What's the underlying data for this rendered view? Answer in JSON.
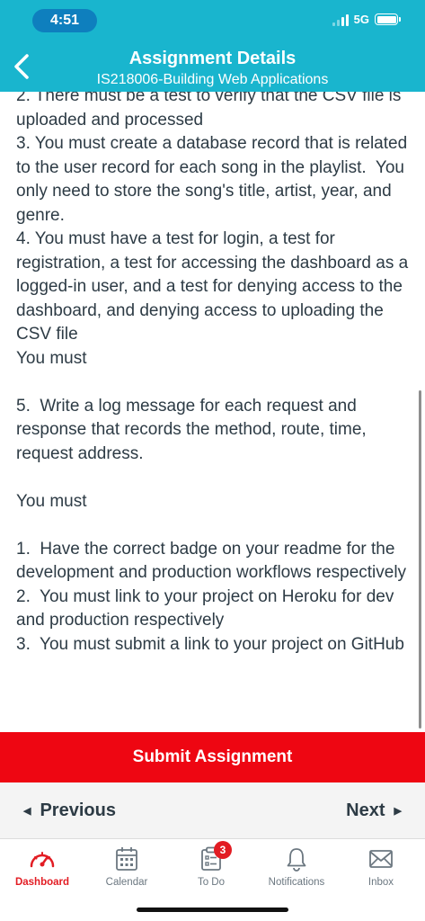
{
  "status_bar": {
    "time": "4:51",
    "network": "5G"
  },
  "header": {
    "title": "Assignment Details",
    "subtitle": "IS218006-Building Web Applications"
  },
  "content": {
    "lines": [
      "2. There must be a test to verify that the CSV file is uploaded and processed",
      "3. You must create a database record that is related to the user record for each song in the playlist.  You only need to store the song's title, artist, year, and genre.",
      "4. You must have a test for login, a test for registration, a test for accessing the dashboard as a logged-in user, and a test for denying access to the dashboard, and denying access to uploading the CSV file",
      "You must",
      "",
      "5.  Write a log message for each request and response that records the method, route, time, request address.",
      "",
      "You must",
      "",
      "1.  Have the correct badge on your readme for the development and production workflows respectively",
      "2.  You must link to your project on Heroku for dev and production respectively",
      "3.  You must submit a link to your project on GitHub"
    ]
  },
  "submit_button": {
    "label": "Submit Assignment"
  },
  "pager": {
    "previous_label": "Previous",
    "next_label": "Next"
  },
  "tabbar": {
    "tabs": [
      {
        "label": "Dashboard",
        "icon": "speedometer-icon",
        "active": true
      },
      {
        "label": "Calendar",
        "icon": "calendar-icon"
      },
      {
        "label": "To Do",
        "icon": "clipboard-icon",
        "badge": "3"
      },
      {
        "label": "Notifications",
        "icon": "bell-icon"
      },
      {
        "label": "Inbox",
        "icon": "envelope-icon"
      }
    ]
  },
  "colors": {
    "header": "#19b5ce",
    "time_pill": "#0e7fbe",
    "submit": "#ee0612",
    "active_tab": "#e21c23",
    "text": "#2d3b45"
  }
}
